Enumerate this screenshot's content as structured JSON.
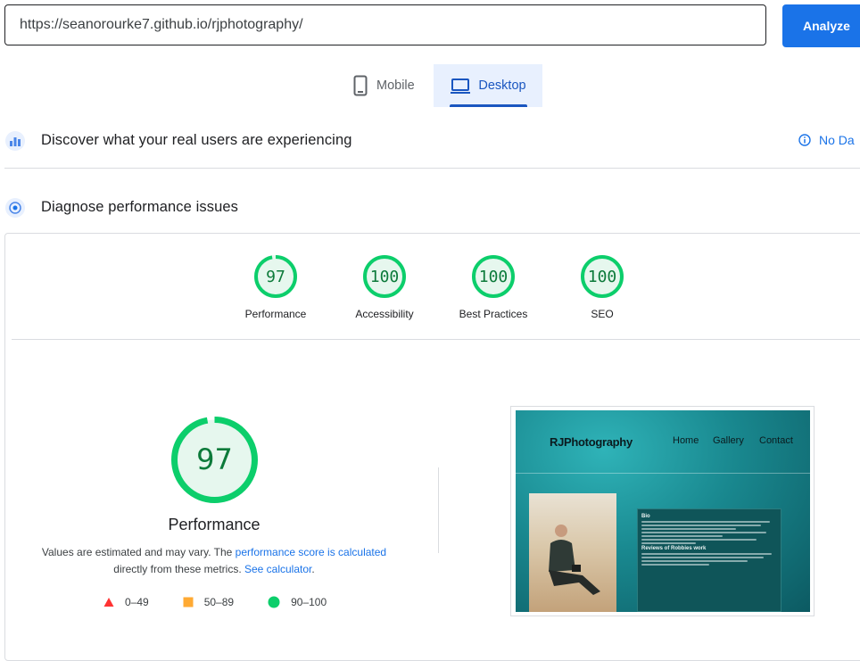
{
  "search": {
    "url_value": "https://seanorourke7.github.io/rjphotography/",
    "analyze_label": "Analyze"
  },
  "device_tabs": {
    "mobile_label": "Mobile",
    "desktop_label": "Desktop",
    "selected": "Desktop"
  },
  "crux": {
    "title": "Discover what your real users are experiencing",
    "no_data_label": "No Da"
  },
  "diagnose": {
    "title": "Diagnose performance issues"
  },
  "scores": [
    {
      "label": "Performance",
      "value": "97",
      "fraction": 0.97
    },
    {
      "label": "Accessibility",
      "value": "100",
      "fraction": 1.0
    },
    {
      "label": "Best Practices",
      "value": "100",
      "fraction": 1.0
    },
    {
      "label": "SEO",
      "value": "100",
      "fraction": 1.0
    }
  ],
  "performance": {
    "score": "97",
    "fraction": 0.97,
    "label": "Performance",
    "note_prefix": "Values are estimated and may vary. The ",
    "note_link1": "performance score is calculated",
    "note_middle": "directly from these metrics. ",
    "note_link2": "See calculator",
    "note_suffix": "."
  },
  "legend": [
    {
      "range": "0–49",
      "shape": "triangle",
      "color": "#ff3333"
    },
    {
      "range": "50–89",
      "shape": "square",
      "color": "#ffaa33"
    },
    {
      "range": "90–100",
      "shape": "circle",
      "color": "#0cce6b"
    }
  ],
  "colors": {
    "accent": "#1a73e8",
    "pass_green": "#0cce6b",
    "pass_text": "#0c7a3a",
    "pass_fill": "#e6f7ee"
  },
  "thumbnail": {
    "brand": "RJPhotography",
    "nav": [
      "Home",
      "Gallery",
      "Contact"
    ],
    "bio_heading": "Bio",
    "reviews_heading": "Reviews of Robbies work"
  }
}
